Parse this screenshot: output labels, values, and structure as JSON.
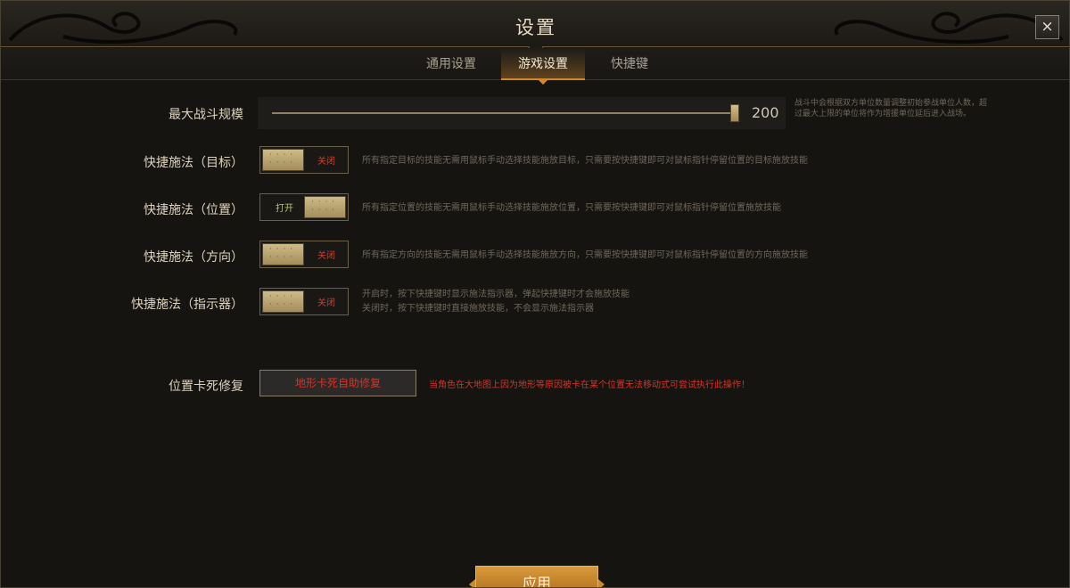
{
  "window": {
    "title": "设置",
    "close_label": "×"
  },
  "tabs": [
    {
      "label": "通用设置",
      "active": false
    },
    {
      "label": "游戏设置",
      "active": true
    },
    {
      "label": "快捷键",
      "active": false
    }
  ],
  "battle_scale": {
    "label": "最大战斗规模",
    "value": "200",
    "fill_fraction": 1.0,
    "desc": "战斗中会根据双方单位数量调整初始参战单位人数，超过最大上限的单位将作为增援单位延后进入战场。"
  },
  "toggles": [
    {
      "label": "快捷施法（目标）",
      "state": "off",
      "state_text": "关闭",
      "desc": [
        "所有指定目标的技能无需用鼠标手动选择技能施放目标，只需要按快捷键即可对鼠标指针停留位置的目标施放技能"
      ]
    },
    {
      "label": "快捷施法（位置）",
      "state": "on",
      "state_text": "打开",
      "desc": [
        "所有指定位置的技能无需用鼠标手动选择技能施放位置，只需要按快捷键即可对鼠标指针停留位置施放技能"
      ]
    },
    {
      "label": "快捷施法（方向）",
      "state": "off",
      "state_text": "关闭",
      "desc": [
        "所有指定方向的技能无需用鼠标手动选择技能施放方向，只需要按快捷键即可对鼠标指针停留位置的方向施放技能"
      ]
    },
    {
      "label": "快捷施法（指示器）",
      "state": "off",
      "state_text": "关闭",
      "desc": [
        "开启时，按下快捷键时显示施法指示器，弹起快捷键时才会施放技能",
        "关闭时，按下快捷键时直接施放技能，不会显示施法指示器"
      ]
    }
  ],
  "repair": {
    "label": "位置卡死修复",
    "button_label": "地形卡死自助修复",
    "warning": "当角色在大地图上因为地形等原因被卡在某个位置无法移动式可尝试执行此操作！"
  },
  "apply_label": "应用"
}
